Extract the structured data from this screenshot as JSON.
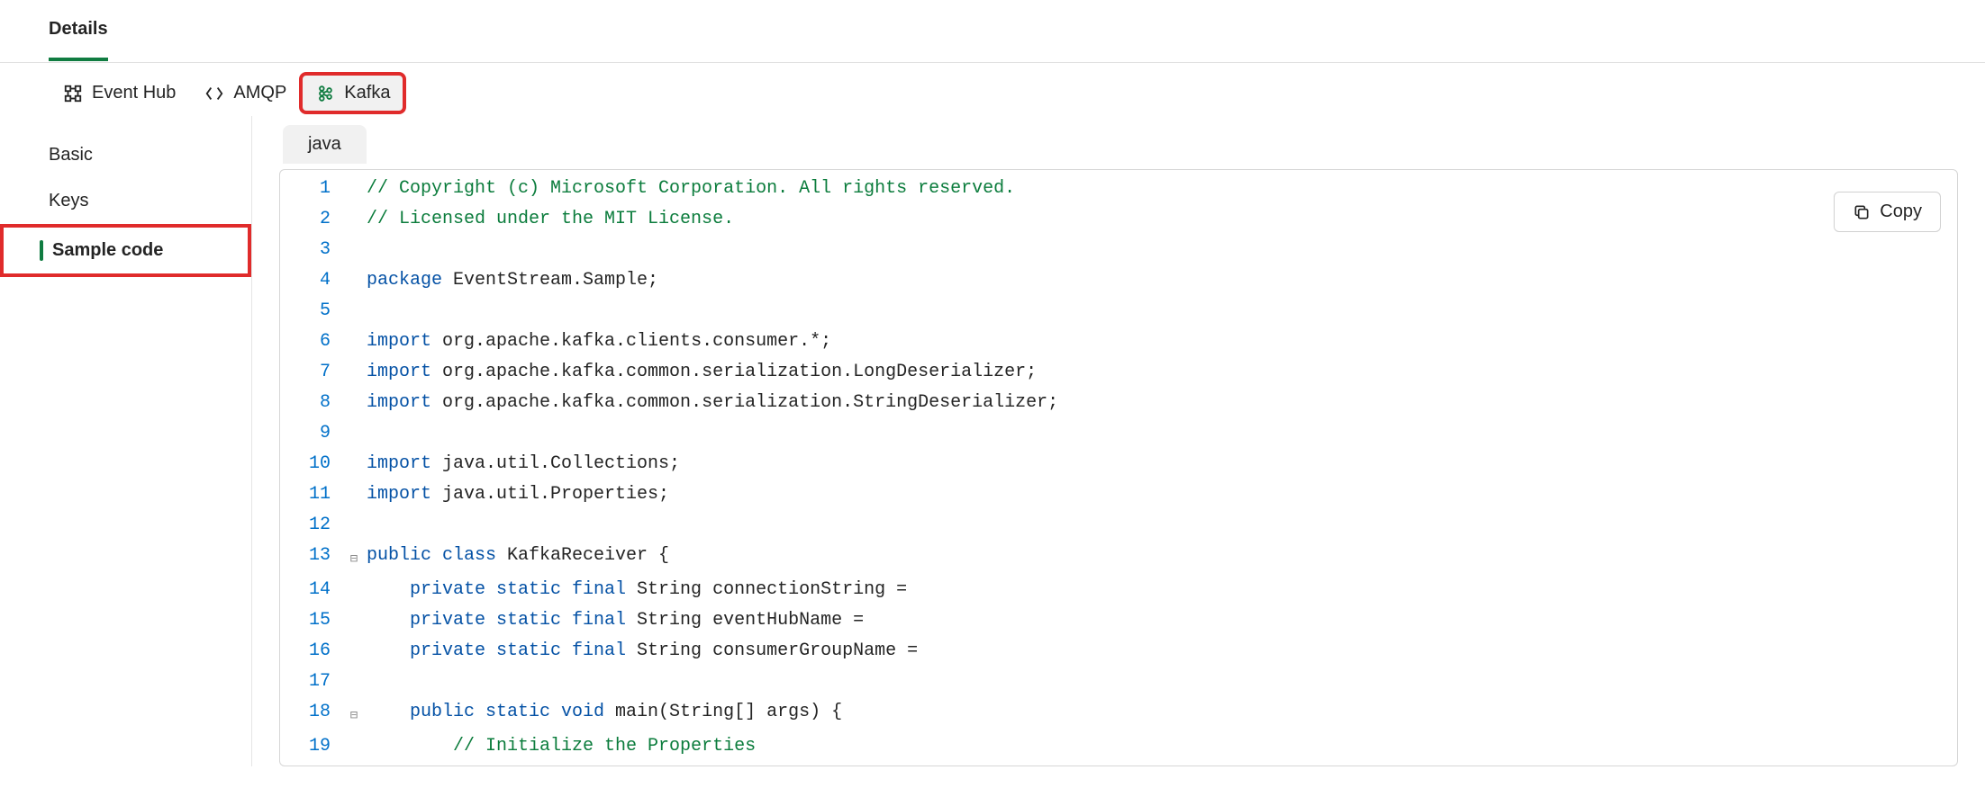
{
  "header": {
    "title": "Details"
  },
  "protocolTabs": {
    "eventHub": "Event Hub",
    "amqp": "AMQP",
    "kafka": "Kafka"
  },
  "sidebar": {
    "basic": "Basic",
    "keys": "Keys",
    "sampleCode": "Sample code"
  },
  "langTab": "java",
  "copyLabel": "Copy",
  "code": {
    "l1": "// Copyright (c) Microsoft Corporation. All rights reserved.",
    "l2": "// Licensed under the MIT License.",
    "l3": "",
    "l4a": "package",
    "l4b": " EventStream.Sample;",
    "l5": "",
    "l6a": "import",
    "l6b": " org.apache.kafka.clients.consumer.*;",
    "l7a": "import",
    "l7b": " org.apache.kafka.common.serialization.LongDeserializer;",
    "l8a": "import",
    "l8b": " org.apache.kafka.common.serialization.StringDeserializer;",
    "l9": "",
    "l10a": "import",
    "l10b": " java.util.Collections;",
    "l11a": "import",
    "l11b": " java.util.Properties;",
    "l12": "",
    "l13a": "public class",
    "l13b": " KafkaReceiver {",
    "l14a": "    private static final",
    "l14b": " String connectionString =",
    "l15a": "    private static final",
    "l15b": " String eventHubName =",
    "l16a": "    private static final",
    "l16b": " String consumerGroupName =",
    "l17": "",
    "l18a": "    public static void",
    "l18b": " main(String[] args) {",
    "l19": "        // Initialize the Properties"
  }
}
